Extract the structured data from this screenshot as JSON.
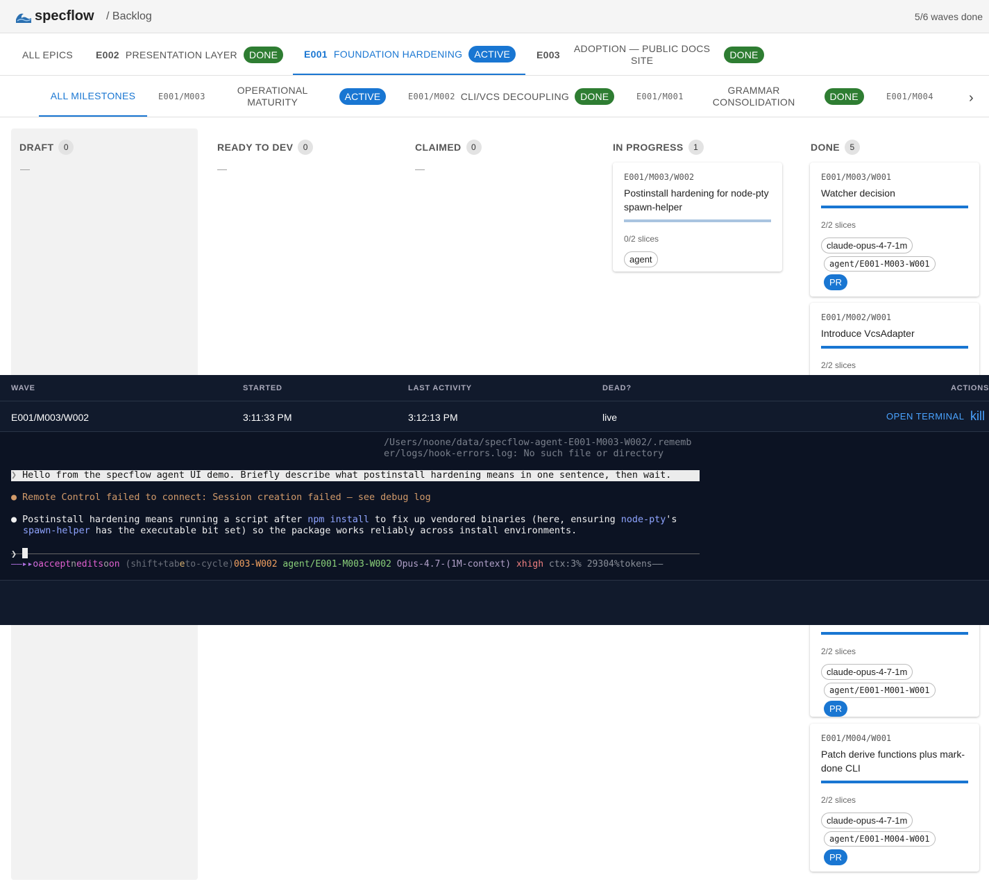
{
  "app": {
    "brand": "specflow",
    "breadcrumb": "/ Backlog",
    "waves_done": "5/6 waves done"
  },
  "epic_tabs": [
    {
      "label": "ALL EPICS"
    },
    {
      "code": "E002",
      "name": "PRESENTATION LAYER",
      "status": "DONE"
    },
    {
      "code": "E001",
      "name": "FOUNDATION HARDENING",
      "status": "ACTIVE"
    },
    {
      "code": "E003",
      "name_line1": "ADOPTION — PUBLIC DOCS",
      "name_line2": "SITE",
      "status": "DONE"
    }
  ],
  "milestone_tabs": [
    {
      "label": "ALL MILESTONES"
    },
    {
      "id": "E001/M003",
      "name_line1": "OPERATIONAL",
      "name_line2": "MATURITY",
      "status": "ACTIVE"
    },
    {
      "id": "E001/M002",
      "name": "CLI/VCS DECOUPLING",
      "status": "DONE"
    },
    {
      "id": "E001/M001",
      "name_line1": "GRAMMAR",
      "name_line2": "CONSOLIDATION",
      "status": "DONE"
    },
    {
      "id": "E001/M004"
    }
  ],
  "columns": {
    "draft": {
      "title": "DRAFT",
      "count": "0",
      "empty": "—"
    },
    "ready": {
      "title": "READY TO DEV",
      "count": "0",
      "empty": "—"
    },
    "claimed": {
      "title": "CLAIMED",
      "count": "0",
      "empty": "—"
    },
    "in_progress": {
      "title": "IN PROGRESS",
      "count": "1"
    },
    "done": {
      "title": "DONE",
      "count": "5"
    }
  },
  "cards": {
    "ip1": {
      "id": "E001/M003/W002",
      "title": "Postinstall hardening for node-pty spawn-helper",
      "slices": "0/2 slices",
      "progress": 0,
      "tag": "agent"
    },
    "d1": {
      "id": "E001/M003/W001",
      "title": "Watcher decision",
      "slices": "2/2 slices",
      "progress": 1,
      "model": "claude-opus-4-7-1m",
      "branch": "agent/E001-M003-W001",
      "pr": "PR"
    },
    "d2": {
      "id": "E001/M002/W001",
      "title": "Introduce VcsAdapter",
      "slices": "2/2 slices",
      "progress": 1
    },
    "d3": {
      "slices": "2/2 slices",
      "progress": 1,
      "model": "claude-opus-4-7-1m",
      "branch": "agent/E001-M001-W001",
      "pr": "PR"
    },
    "d4": {
      "id": "E001/M004/W001",
      "title": "Patch derive functions plus mark-done CLI",
      "slices": "2/2 slices",
      "progress": 1,
      "model": "claude-opus-4-7-1m",
      "branch": "agent/E001-M004-W001",
      "pr": "PR"
    }
  },
  "panel": {
    "headers": {
      "wave": "WAVE",
      "started": "STARTED",
      "last": "LAST ACTIVITY",
      "dead": "DEAD?",
      "actions": "ACTIONS"
    },
    "row": {
      "wave": "E001/M003/W002",
      "started": "3:11:33 PM",
      "last": "3:12:13 PM",
      "dead": "live",
      "open": "OPEN TERMINAL",
      "kill": "kill"
    }
  },
  "terminal": {
    "err1": "/Users/noone/data/specflow-agent-E001-M003-W002/.rememb",
    "err2": "er/logs/hook-errors.log: No such file or directory",
    "prompt_glyph": "❯",
    "prompt_text": "Hello from the specflow agent UI demo. Briefly describe what postinstall hardening means in one sentence, then wait.",
    "warn": "Remote Control failed to connect: Session creation failed — see debug log",
    "resp_a": "Postinstall hardening means running a script after ",
    "resp_npm": "npm install",
    "resp_b": " to fix up vendored binaries (here, ensuring ",
    "resp_pty": "node-pty",
    "resp_c": "'s",
    "resp_spawn": "spawn-helper",
    "resp_d": " has the executable bit set) so the package works reliably across install environments.",
    "status_lead": "——▸▸",
    "status_a1": "o",
    "status_a2": "accept",
    "status_a3": "n",
    "status_a4": "edits",
    "status_a5": "o",
    "status_a6": "on",
    "status_hint1": " (shift+tab",
    "status_hint2": "e",
    "status_hint3": "to-cycle)",
    "status_wave": "003-W002 ",
    "status_branch": "agent/E001-M003-W002 ",
    "status_model": "Opus-4.7-(1M-context) ",
    "status_effort": "xhigh ",
    "status_ctx": "ctx:3% 29304%tokens——"
  },
  "colors": {
    "primary": "#1976d2",
    "done": "#2e7d32",
    "panel": "#111a2c"
  }
}
